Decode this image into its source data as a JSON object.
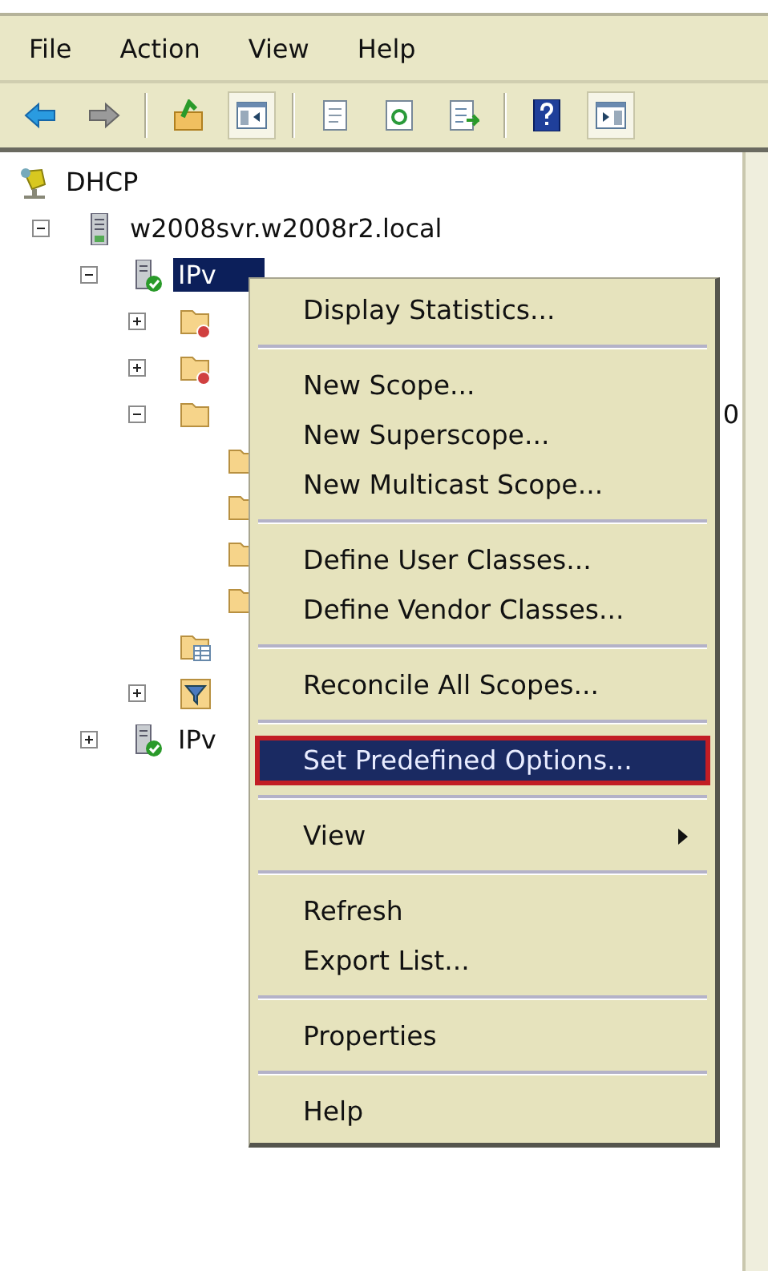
{
  "menubar": {
    "items": [
      {
        "label": "File"
      },
      {
        "label": "Action"
      },
      {
        "label": "View"
      },
      {
        "label": "Help"
      }
    ]
  },
  "toolbar": {
    "groups": [
      [
        {
          "kind": "back",
          "pressed": false
        },
        {
          "kind": "forward",
          "pressed": false
        }
      ],
      [
        {
          "kind": "up",
          "pressed": false
        },
        {
          "kind": "console-tree",
          "pressed": true
        }
      ],
      [
        {
          "kind": "properties",
          "pressed": false
        },
        {
          "kind": "refresh",
          "pressed": false
        },
        {
          "kind": "export",
          "pressed": false
        }
      ],
      [
        {
          "kind": "help",
          "pressed": false
        },
        {
          "kind": "action-pane",
          "pressed": true
        }
      ]
    ]
  },
  "tree": [
    {
      "kind": "dhcp",
      "label": "DHCP",
      "selected": false,
      "children": [
        {
          "kind": "server",
          "label": "w2008svr.w2008r2.local",
          "expanded": true,
          "selected": false,
          "children": [
            {
              "kind": "server-check",
              "label": "IPv",
              "expanded": true,
              "selected": true,
              "children": [
                {
                  "kind": "scope-alert",
                  "expanded": false,
                  "selected": false
                },
                {
                  "kind": "scope-alert",
                  "expanded": false,
                  "selected": false
                },
                {
                  "kind": "folder",
                  "label_tail": "0",
                  "expanded": true,
                  "selected": false,
                  "children": [
                    {
                      "kind": "folder",
                      "selected": false
                    },
                    {
                      "kind": "folder",
                      "selected": false
                    },
                    {
                      "kind": "folder",
                      "selected": false
                    },
                    {
                      "kind": "folder",
                      "selected": false
                    }
                  ]
                },
                {
                  "kind": "options",
                  "selected": false
                },
                {
                  "kind": "filter",
                  "expanded": false,
                  "selected": false
                }
              ]
            },
            {
              "kind": "server-check",
              "label": "IPv",
              "expanded": false,
              "selected": false
            }
          ]
        }
      ]
    }
  ],
  "context_menu": {
    "groups": [
      [
        {
          "label": "Display Statistics...",
          "selected": false,
          "submenu": false
        }
      ],
      [
        {
          "label": "New Scope...",
          "selected": false,
          "submenu": false
        },
        {
          "label": "New Superscope...",
          "selected": false,
          "submenu": false
        },
        {
          "label": "New Multicast Scope...",
          "selected": false,
          "submenu": false
        }
      ],
      [
        {
          "label": "Define User Classes...",
          "selected": false,
          "submenu": false
        },
        {
          "label": "Define Vendor Classes...",
          "selected": false,
          "submenu": false
        }
      ],
      [
        {
          "label": "Reconcile All Scopes...",
          "selected": false,
          "submenu": false
        }
      ],
      [
        {
          "label": "Set Predefined Options...",
          "selected": true,
          "submenu": false
        }
      ],
      [
        {
          "label": "View",
          "selected": false,
          "submenu": true
        }
      ],
      [
        {
          "label": "Refresh",
          "selected": false,
          "submenu": false
        },
        {
          "label": "Export List...",
          "selected": false,
          "submenu": false
        }
      ],
      [
        {
          "label": "Properties",
          "selected": false,
          "submenu": false
        }
      ],
      [
        {
          "label": "Help",
          "selected": false,
          "submenu": false
        }
      ]
    ]
  }
}
